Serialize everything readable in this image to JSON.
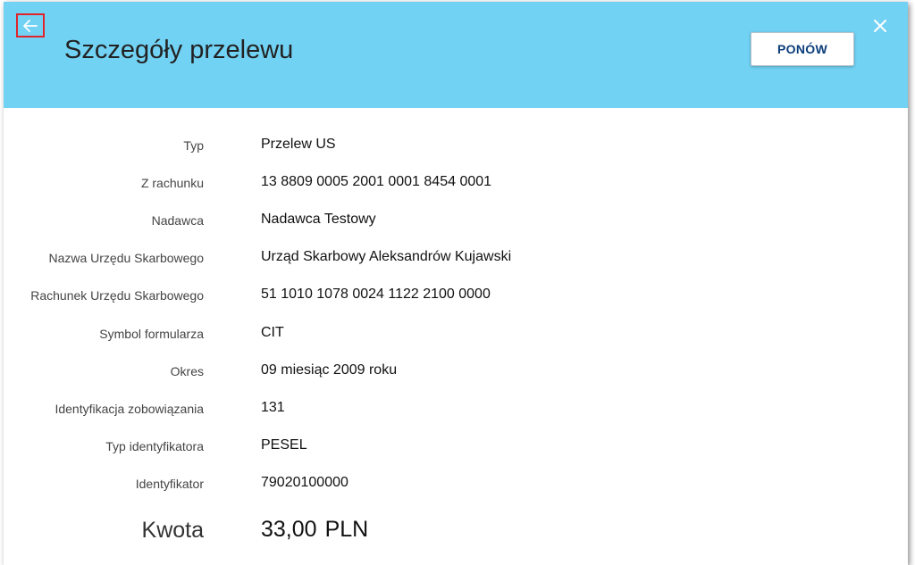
{
  "header": {
    "title": "Szczegóły przelewu",
    "retry_label": "PONÓW",
    "background_color": "#72d2f4",
    "back_icon": "arrow-left-icon",
    "close_icon": "close-icon"
  },
  "details": [
    {
      "label": "Typ",
      "value": "Przelew US"
    },
    {
      "label": "Z rachunku",
      "value": "13 8809 0005 2001 0001 8454 0001"
    },
    {
      "label": "Nadawca",
      "value": "Nadawca Testowy"
    },
    {
      "label": "Nazwa Urzędu Skarbowego",
      "value": "Urząd Skarbowy Aleksandrów Kujawski"
    },
    {
      "label": "Rachunek Urzędu Skarbowego",
      "value": "51 1010 1078 0024 1122 2100 0000"
    },
    {
      "label": "Symbol formularza",
      "value": "CIT"
    },
    {
      "label": "Okres",
      "value": "09 miesiąc 2009 roku"
    },
    {
      "label": "Identyfikacja zobowiązania",
      "value": "131"
    },
    {
      "label": "Typ identyfikatora",
      "value": "PESEL"
    },
    {
      "label": "Identyfikator",
      "value": "79020100000"
    }
  ],
  "amount": {
    "label": "Kwota",
    "value": "33,00",
    "currency": "PLN"
  }
}
